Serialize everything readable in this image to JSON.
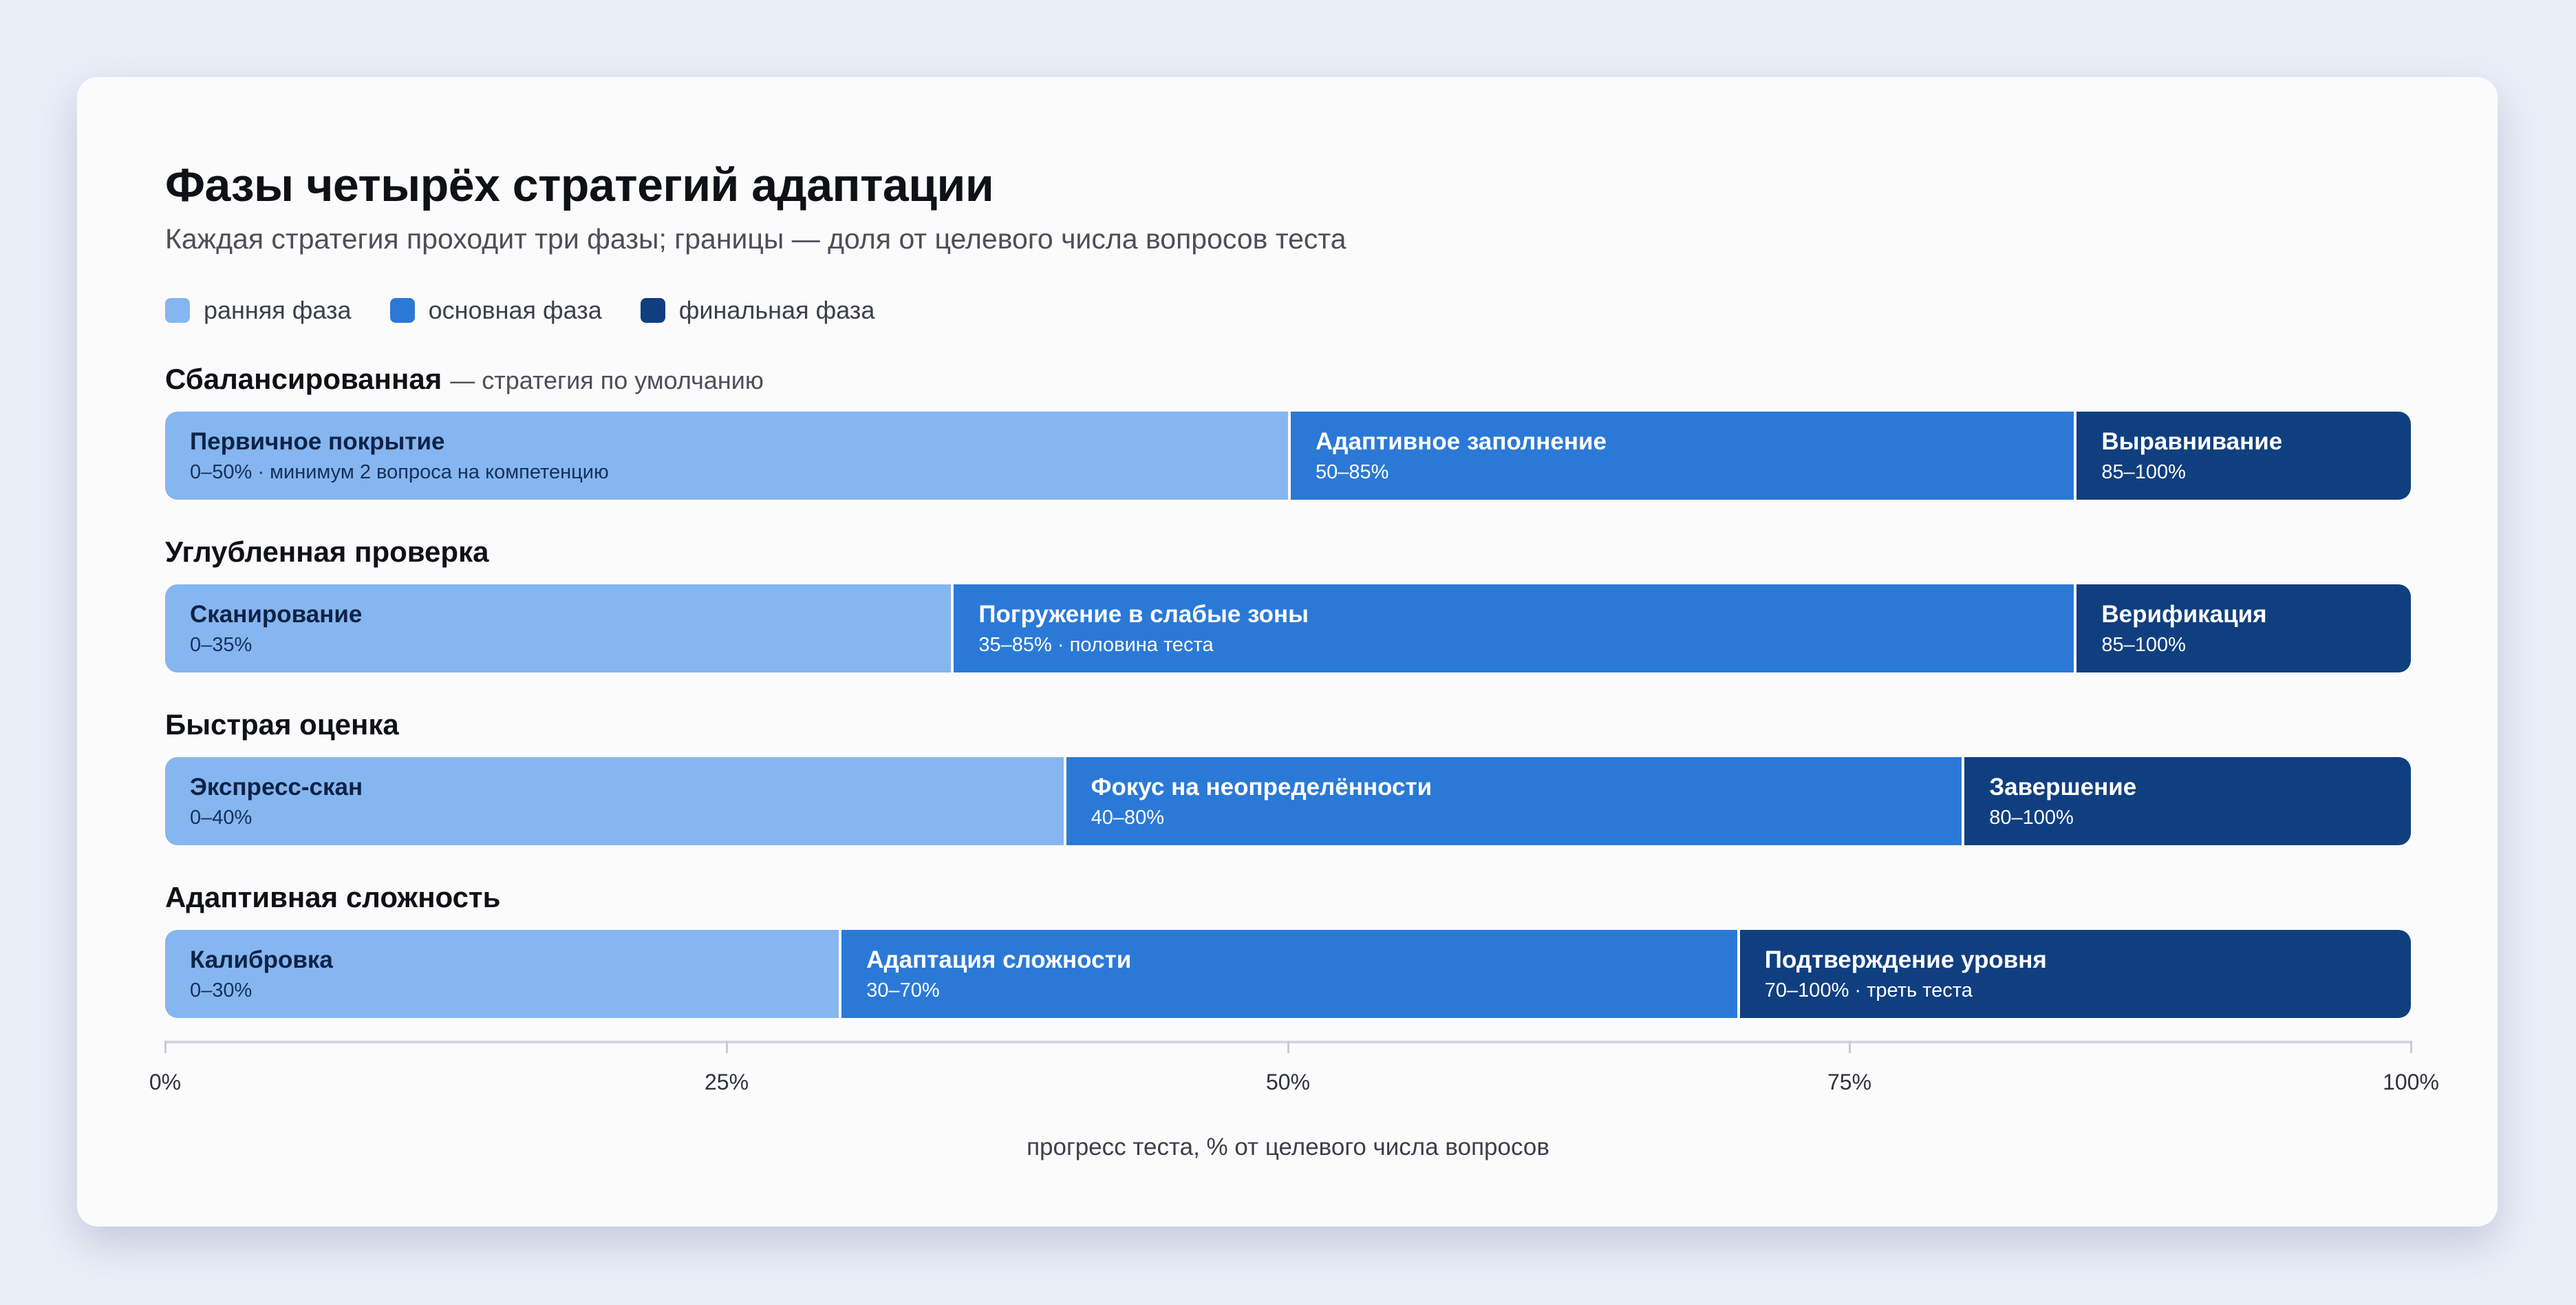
{
  "colors": {
    "early": "#86b6ef",
    "main": "#2b79d6",
    "final": "#103f80"
  },
  "chart_data": {
    "type": "bar",
    "orientation": "horizontal",
    "stacked": true,
    "title": "Фазы четырёх стратегий адаптации",
    "subtitle": "Каждая стратегия проходит три фазы; границы — доля от целевого числа вопросов теста",
    "legend": [
      {
        "key": "early",
        "label": "ранняя фаза"
      },
      {
        "key": "main",
        "label": "основная фаза"
      },
      {
        "key": "final",
        "label": "финальная фаза"
      }
    ],
    "legend_position": "top-left",
    "xlim": [
      0,
      100
    ],
    "xticks": [
      0,
      25,
      50,
      75,
      100
    ],
    "xtick_labels": [
      "0%",
      "25%",
      "50%",
      "75%",
      "100%"
    ],
    "xlabel": "прогресс теста, % от целевого числа вопросов",
    "grid": false,
    "strategies": [
      {
        "name": "Сбалансированная",
        "note": "— стратегия по умолчанию",
        "phases": [
          {
            "kind": "early",
            "name": "Первичное покрытие",
            "start": 0,
            "end": 50,
            "range_label": "0–50% · минимум 2 вопроса на компетенцию"
          },
          {
            "kind": "main",
            "name": "Адаптивное заполнение",
            "start": 50,
            "end": 85,
            "range_label": "50–85%"
          },
          {
            "kind": "final",
            "name": "Выравнивание",
            "start": 85,
            "end": 100,
            "range_label": "85–100%"
          }
        ]
      },
      {
        "name": "Углубленная проверка",
        "phases": [
          {
            "kind": "early",
            "name": "Сканирование",
            "start": 0,
            "end": 35,
            "range_label": "0–35%"
          },
          {
            "kind": "main",
            "name": "Погружение в слабые зоны",
            "start": 35,
            "end": 85,
            "range_label": "35–85% · половина теста"
          },
          {
            "kind": "final",
            "name": "Верификация",
            "start": 85,
            "end": 100,
            "range_label": "85–100%"
          }
        ]
      },
      {
        "name": "Быстрая оценка",
        "phases": [
          {
            "kind": "early",
            "name": "Экспресс-скан",
            "start": 0,
            "end": 40,
            "range_label": "0–40%"
          },
          {
            "kind": "main",
            "name": "Фокус на неопределённости",
            "start": 40,
            "end": 80,
            "range_label": "40–80%"
          },
          {
            "kind": "final",
            "name": "Завершение",
            "start": 80,
            "end": 100,
            "range_label": "80–100%"
          }
        ]
      },
      {
        "name": "Адаптивная сложность",
        "phases": [
          {
            "kind": "early",
            "name": "Калибровка",
            "start": 0,
            "end": 30,
            "range_label": "0–30%"
          },
          {
            "kind": "main",
            "name": "Адаптация сложности",
            "start": 30,
            "end": 70,
            "range_label": "30–70%"
          },
          {
            "kind": "final",
            "name": "Подтверждение уровня",
            "start": 70,
            "end": 100,
            "range_label": "70–100% · треть теста"
          }
        ]
      }
    ]
  }
}
